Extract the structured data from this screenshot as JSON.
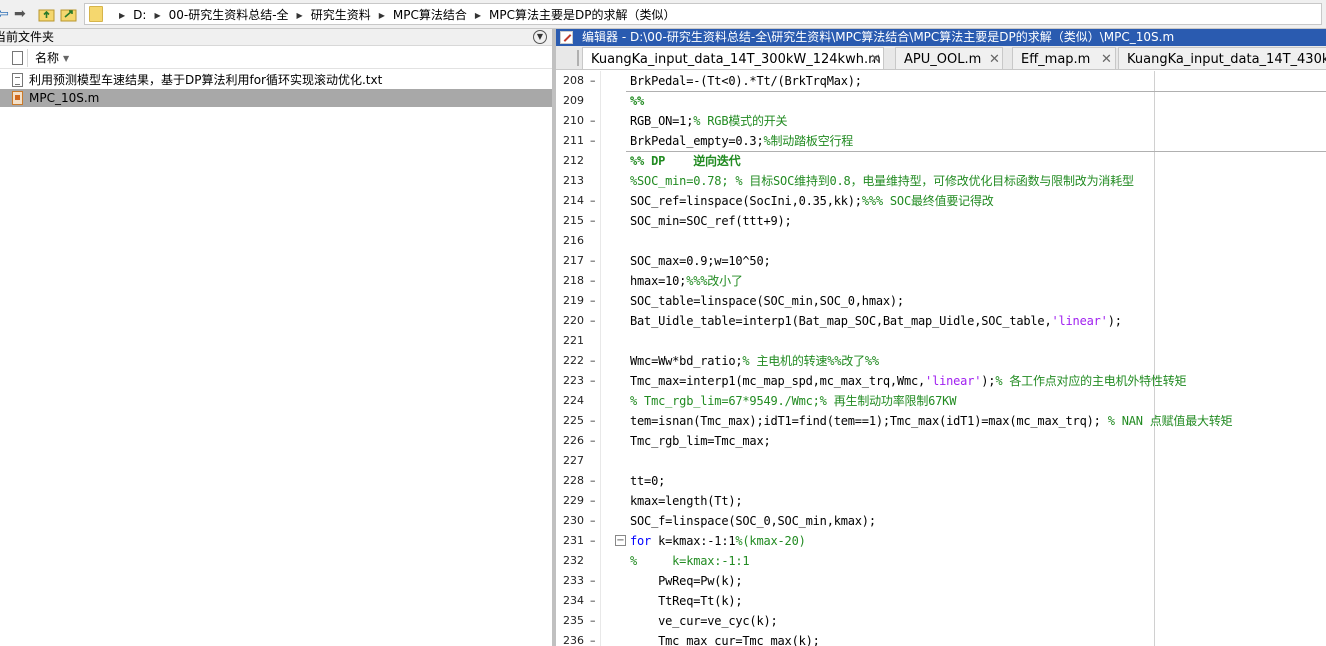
{
  "toolbar": {
    "back_icon": "back-arrow-icon",
    "forward_icon": "forward-arrow-icon",
    "up_icon": "up-folder-icon",
    "browse_icon": "browse-folder-icon"
  },
  "address": {
    "crumbs": [
      "D:",
      "00-研究生资料总结-全",
      "研究生资料",
      "MPC算法结合",
      "MPC算法主要是DP的求解（类似）"
    ]
  },
  "current_folder": {
    "title": "当前文件夹",
    "column_name": "名称",
    "files": [
      {
        "name": "利用预测模型车速结果，基于DP算法利用for循环实现滚动优化.txt",
        "icon": "text-file-icon"
      },
      {
        "name": "MPC_10S.m",
        "icon": "m-file-icon"
      }
    ]
  },
  "editor": {
    "title": "编辑器 - D:\\00-研究生资料总结-全\\研究生资料\\MPC算法结合\\MPC算法主要是DP的求解（类似）\\MPC_10S.m",
    "tabs": [
      {
        "label": "KuangKa_input_data_14T_300kW_124kwh.m"
      },
      {
        "label": "APU_OOL.m"
      },
      {
        "label": "Eff_map.m"
      },
      {
        "label": "KuangKa_input_data_14T_430kW"
      }
    ],
    "lines": [
      {
        "n": "208",
        "dash": "–",
        "code": "BrkPedal=-(Tt<0).*Tt/(BrkTrqMax);"
      },
      {
        "n": "209",
        "dash": "",
        "cell": "%%"
      },
      {
        "n": "210",
        "dash": "–",
        "code": "RGB_ON=1;",
        "comment": "% RGB模式的开关"
      },
      {
        "n": "211",
        "dash": "–",
        "code": "BrkPedal_empty=0.3;",
        "comment": "%制动踏板空行程"
      },
      {
        "n": "212",
        "dash": "",
        "cell": "%% DP    逆向迭代"
      },
      {
        "n": "213",
        "dash": "",
        "comment": "%SOC_min=0.78; % 目标SOC维持到0.8，电量维持型，可修改优化目标函数与限制改为消耗型"
      },
      {
        "n": "214",
        "dash": "–",
        "code": "SOC_ref=linspace(SocIni,0.35,kk);",
        "comment": "%%% SOC最终值要记得改"
      },
      {
        "n": "215",
        "dash": "–",
        "code": "SOC_min=SOC_ref(ttt+9);"
      },
      {
        "n": "216",
        "dash": "",
        "code": ""
      },
      {
        "n": "217",
        "dash": "–",
        "code": "SOC_max=0.9;w=10^50;"
      },
      {
        "n": "218",
        "dash": "–",
        "code": "hmax=10;",
        "comment": "%%%改小了"
      },
      {
        "n": "219",
        "dash": "–",
        "code": "SOC_table=linspace(SOC_min,SOC_0,hmax);"
      },
      {
        "n": "220",
        "dash": "–",
        "code": "Bat_Uidle_table=interp1(Bat_map_SOC,Bat_map_Uidle,SOC_table,",
        "string": "'linear'",
        "after": ");"
      },
      {
        "n": "221",
        "dash": "",
        "code": ""
      },
      {
        "n": "222",
        "dash": "–",
        "code": "Wmc=Ww*bd_ratio;",
        "comment": "% 主电机的转速%%改了%%"
      },
      {
        "n": "223",
        "dash": "–",
        "code": "Tmc_max=interp1(mc_map_spd,mc_max_trq,Wmc,",
        "string": "'linear'",
        "after": ");",
        "comment": "% 各工作点对应的主电机外特性转矩"
      },
      {
        "n": "224",
        "dash": "",
        "comment": "% Tmc_rgb_lim=67*9549./Wmc;% 再生制动功率限制67KW"
      },
      {
        "n": "225",
        "dash": "–",
        "code": "tem=isnan(Tmc_max);idT1=find(tem==1);Tmc_max(idT1)=max(mc_max_trq); ",
        "comment": "% NAN 点赋值最大转矩"
      },
      {
        "n": "226",
        "dash": "–",
        "code": "Tmc_rgb_lim=Tmc_max;"
      },
      {
        "n": "227",
        "dash": "",
        "code": ""
      },
      {
        "n": "228",
        "dash": "–",
        "code": "tt=0;"
      },
      {
        "n": "229",
        "dash": "–",
        "code": "kmax=length(Tt);"
      },
      {
        "n": "230",
        "dash": "–",
        "code": "SOC_f=linspace(SOC_0,SOC_min,kmax);"
      },
      {
        "n": "231",
        "dash": "–",
        "keyword": "for",
        "code": " k=kmax:-1:1",
        "comment": "%(kmax-20)",
        "fold": "−"
      },
      {
        "n": "232",
        "dash": "",
        "comment": "%     k=kmax:-1:1"
      },
      {
        "n": "233",
        "dash": "–",
        "code": "    PwReq=Pw(k);"
      },
      {
        "n": "234",
        "dash": "–",
        "code": "    TtReq=Tt(k);"
      },
      {
        "n": "235",
        "dash": "–",
        "code": "    ve_cur=ve_cyc(k);"
      },
      {
        "n": "236",
        "dash": "–",
        "code": "    Tmc_max_cur=Tmc_max(k);"
      }
    ]
  }
}
